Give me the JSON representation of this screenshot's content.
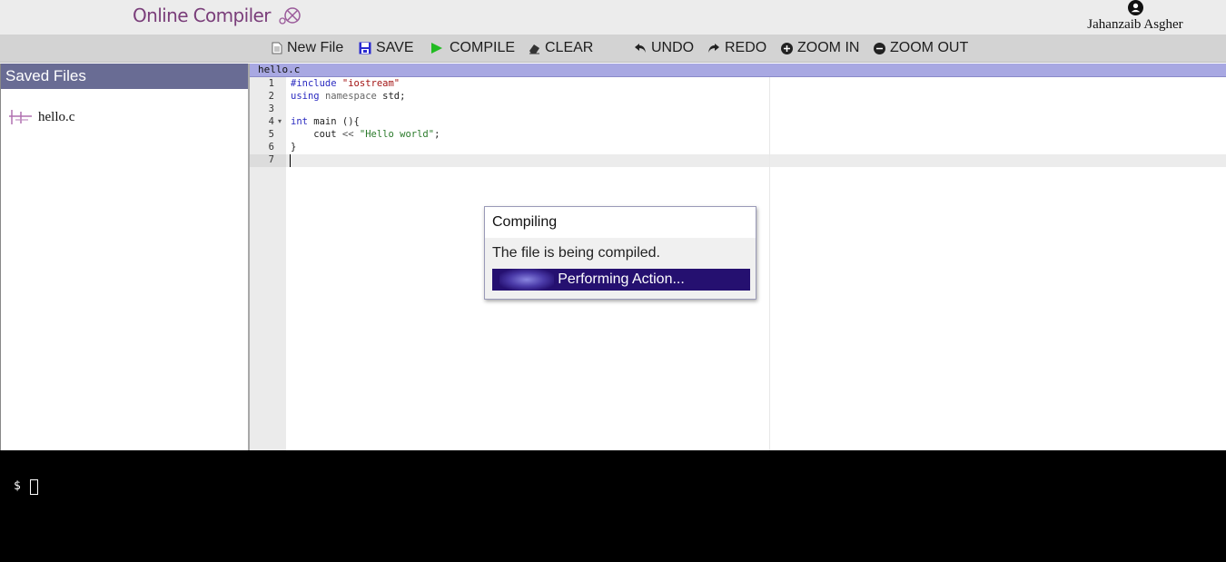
{
  "header": {
    "logo_text": "Online Compiler",
    "user_name": "Jahanzaib Asgher"
  },
  "toolbar": {
    "new_file": "New File",
    "save": "SAVE",
    "compile": "COMPILE",
    "clear": "CLEAR",
    "undo": "UNDO",
    "redo": "REDO",
    "zoom_in": "ZOOM IN",
    "zoom_out": "ZOOM OUT"
  },
  "sidebar": {
    "title": "Saved Files",
    "files": [
      "hello.c"
    ]
  },
  "editor": {
    "tab_label": "hello.c",
    "line_numbers": [
      "1",
      "2",
      "3",
      "4",
      "5",
      "6",
      "7"
    ],
    "code_lines": [
      "#include \"iostream\"",
      "using namespace std;",
      "",
      "int main (){",
      "    cout << \"Hello world\";",
      "}",
      ""
    ]
  },
  "dialog": {
    "title": "Compiling",
    "message": "The file is being compiled.",
    "progress_label": "Performing Action..."
  },
  "terminal": {
    "prompt": "$"
  },
  "colors": {
    "logo": "#7a3e7a",
    "sidebar_header": "#696c94",
    "tab_bar": "#a8a8e2",
    "progress": "#251070",
    "compile_icon": "#22bb22",
    "save_icon": "#2a2ad0"
  }
}
